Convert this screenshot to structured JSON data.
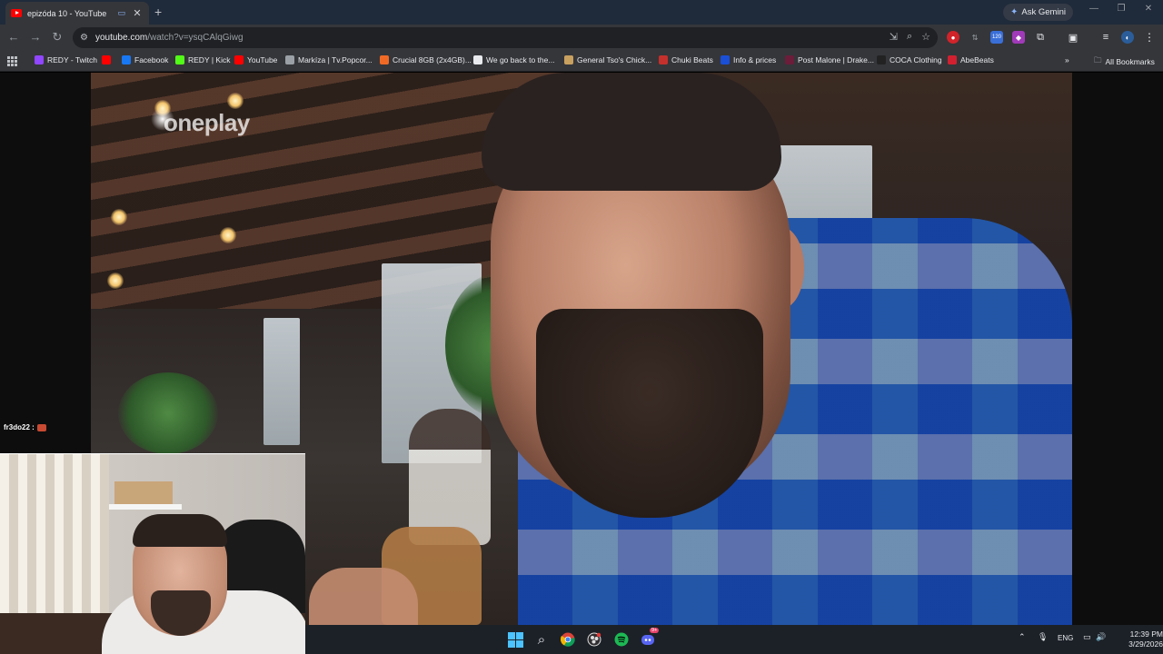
{
  "browser": {
    "tab": {
      "title": "epizóda 10 - YouTube"
    },
    "gemini_label": "Ask Gemini",
    "url_host": "youtube.com",
    "url_path": "/watch?v=ysqCAlqGiwg",
    "extension_badge": "120",
    "bookmarks": [
      {
        "label": "REDY - Twitch",
        "icon": "twitch-icon",
        "color": "#9146ff"
      },
      {
        "label": "",
        "icon": "youtube-icon",
        "color": "#ff0000"
      },
      {
        "label": "Facebook",
        "icon": "facebook-icon",
        "color": "#1877f2"
      },
      {
        "label": "REDY | Kick",
        "icon": "kick-icon",
        "color": "#53fc18"
      },
      {
        "label": "YouTube",
        "icon": "youtube-icon",
        "color": "#ff0000"
      },
      {
        "label": "Markíza | Tv.Popcor...",
        "icon": "globe-icon",
        "color": "#9aa0a6"
      },
      {
        "label": "Crucial 8GB (2x4GB)...",
        "icon": "shop-icon",
        "color": "#f06a26"
      },
      {
        "label": "We go back to the...",
        "icon": "google-icon",
        "color": "#e8eaed"
      },
      {
        "label": "General Tso's Chick...",
        "icon": "food-icon",
        "color": "#c8a060"
      },
      {
        "label": "Chuki Beats",
        "icon": "music-icon",
        "color": "#c4302b"
      },
      {
        "label": "Info & prices",
        "icon": "b-icon",
        "color": "#1a4fd6"
      },
      {
        "label": "Post Malone | Drake...",
        "icon": "music-icon",
        "color": "#6b1d3a"
      },
      {
        "label": "COCA Clothing",
        "icon": "clothing-icon",
        "color": "#222222"
      },
      {
        "label": "AbeBeats",
        "icon": "music-icon",
        "color": "#d22030"
      }
    ],
    "all_bookmarks_label": "All Bookmarks"
  },
  "video": {
    "watermark": "oneplay"
  },
  "chat": {
    "username": "fr3do22 :"
  },
  "taskbar": {
    "language": "ENG",
    "time": "12:39 PM",
    "date": "3/29/2026",
    "discord_badge": "9+"
  },
  "colors": {
    "accent": "#4cc2ff",
    "youtube_red": "#ff0000"
  }
}
